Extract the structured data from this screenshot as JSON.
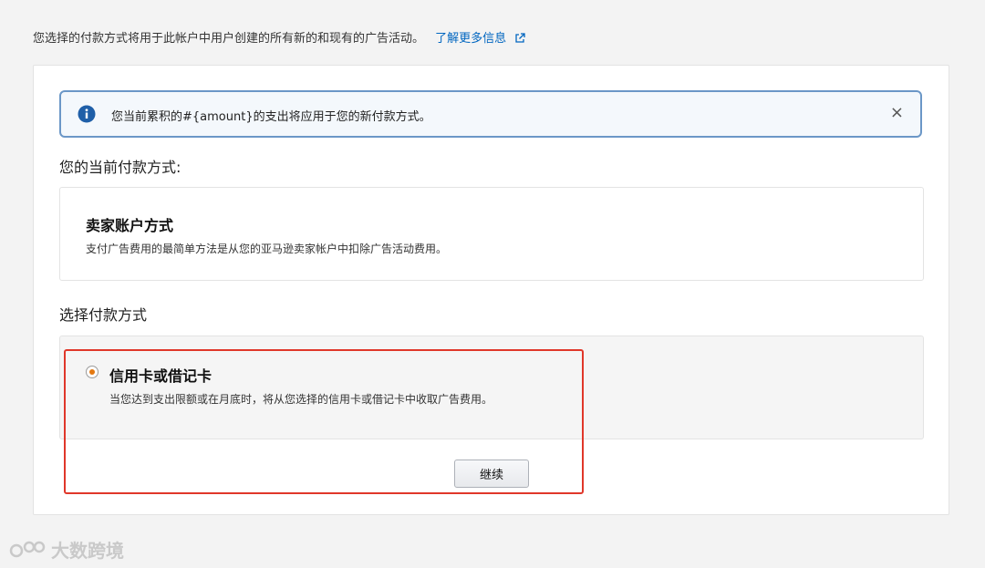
{
  "intro": {
    "text": "您选择的付款方式将用于此帐户中用户创建的所有新的和现有的广告活动。",
    "learn_more": "了解更多信息"
  },
  "alert": {
    "message": "您当前累积的#{amount}的支出将应用于您的新付款方式。",
    "close_glyph": "×"
  },
  "current_section": {
    "heading": "您的当前付款方式:",
    "method_title": "卖家账户方式",
    "method_desc": "支付广告费用的最简单方法是从您的亚马逊卖家帐户中扣除广告活动费用。"
  },
  "select_section": {
    "heading": "选择付款方式",
    "option_title": "信用卡或借记卡",
    "option_desc": "当您达到支出限额或在月底时，将从您选择的信用卡或借记卡中收取广告费用。",
    "option_selected": true,
    "continue_label": "继续"
  },
  "watermark": {
    "text": "大数跨境"
  },
  "colors": {
    "link": "#0066c0",
    "info": "#1f5fa8",
    "radio_selected": "#e47911",
    "highlight_border": "#e0372a"
  }
}
